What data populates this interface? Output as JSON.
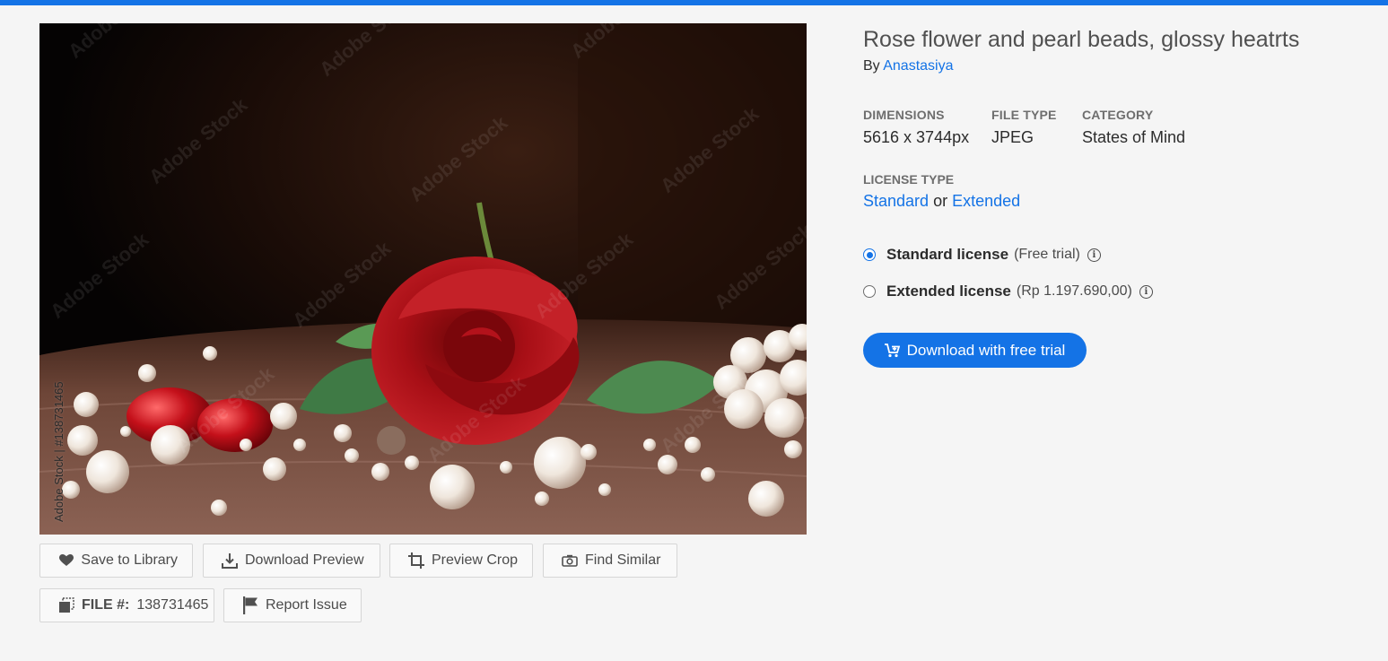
{
  "asset": {
    "title": "Rose flower and pearl beads, glossy heatrts",
    "by_label": "By",
    "author": "Anastasiya",
    "preview_watermark": "Adobe Stock",
    "preview_side_label": "Adobe Stock | #138731465"
  },
  "details": {
    "dimensions_label": "DIMENSIONS",
    "dimensions_value": "5616 x 3744px",
    "filetype_label": "FILE TYPE",
    "filetype_value": "JPEG",
    "category_label": "CATEGORY",
    "category_value": "States of Mind"
  },
  "license": {
    "type_label": "LICENSE TYPE",
    "standard": "Standard",
    "or": "or",
    "extended": "Extended",
    "options": [
      {
        "name": "Standard license",
        "note": "(Free trial)",
        "selected": true
      },
      {
        "name": "Extended license",
        "note": "(Rp 1.197.690,00)",
        "selected": false
      }
    ],
    "cta_label": "Download with free trial"
  },
  "actions": {
    "save": "Save to Library",
    "download_preview": "Download Preview",
    "preview_crop": "Preview Crop",
    "find_similar": "Find Similar",
    "file_label": "FILE #:",
    "file_number": "138731465",
    "report": "Report Issue"
  },
  "colors": {
    "accent": "#1473e6",
    "background": "#f5f5f5",
    "rose": "#b3121b"
  },
  "icons": {
    "save": "heart-icon",
    "download_preview": "download-icon",
    "preview_crop": "crop-icon",
    "find_similar": "camera-icon",
    "file": "copy-icon",
    "report": "flag-icon",
    "cta": "cart-icon",
    "info": "info-icon"
  }
}
